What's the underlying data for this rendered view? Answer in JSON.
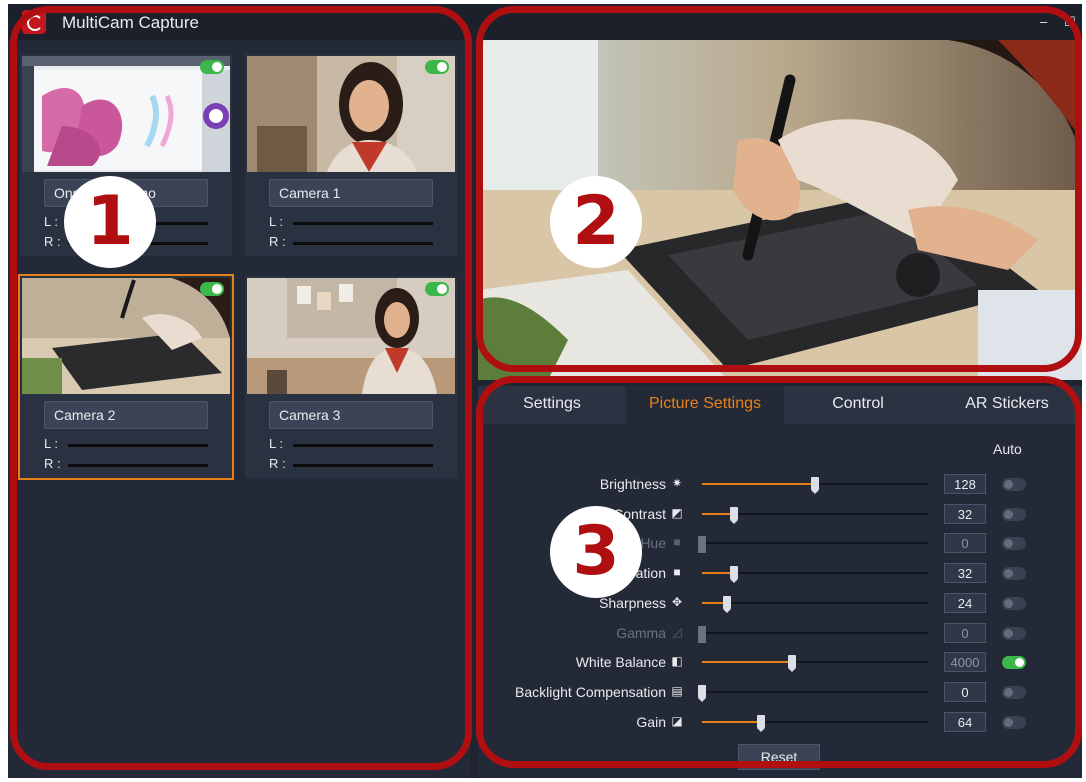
{
  "app": {
    "title": "MultiCam Capture",
    "minimize": "–",
    "maximize": "☐"
  },
  "cameras": [
    {
      "name": "Onscreen Demo",
      "left_label": "L :",
      "right_label": "R :",
      "enabled": true,
      "selected": false
    },
    {
      "name": "Camera 1",
      "left_label": "L :",
      "right_label": "R :",
      "enabled": true,
      "selected": false
    },
    {
      "name": "Camera 2",
      "left_label": "L :",
      "right_label": "R :",
      "enabled": true,
      "selected": true
    },
    {
      "name": "Camera 3",
      "left_label": "L :",
      "right_label": "R :",
      "enabled": true,
      "selected": false
    }
  ],
  "tabs": [
    {
      "label": "Settings",
      "active": false
    },
    {
      "label": "Picture Settings",
      "active": true
    },
    {
      "label": "Control",
      "active": false
    },
    {
      "label": "AR Stickers",
      "active": false
    }
  ],
  "picture_settings": {
    "auto_label": "Auto",
    "rows": [
      {
        "label": "Brightness",
        "icon": "sun-icon",
        "glyph": "✷",
        "value": "128",
        "level": 0.5,
        "enabled": true,
        "auto": false
      },
      {
        "label": "Contrast",
        "icon": "contrast-icon",
        "glyph": "◩",
        "value": "32",
        "level": 0.14,
        "enabled": true,
        "auto": false
      },
      {
        "label": "Hue",
        "icon": "hue-icon",
        "glyph": "■",
        "value": "0",
        "level": 0.0,
        "enabled": false,
        "auto": false
      },
      {
        "label": "Saturation",
        "icon": "saturation-icon",
        "glyph": "■",
        "value": "32",
        "level": 0.14,
        "enabled": true,
        "auto": false
      },
      {
        "label": "Sharpness",
        "icon": "sharpness-icon",
        "glyph": "✥",
        "value": "24",
        "level": 0.11,
        "enabled": true,
        "auto": false
      },
      {
        "label": "Gamma",
        "icon": "gamma-icon",
        "glyph": "◿",
        "value": "0",
        "level": 0.0,
        "enabled": false,
        "auto": false
      },
      {
        "label": "White Balance",
        "icon": "white-balance-icon",
        "glyph": "◧",
        "value": "4000",
        "level": 0.4,
        "enabled": true,
        "auto": true
      },
      {
        "label": "Backlight Compensation",
        "icon": "backlight-icon",
        "glyph": "▤",
        "value": "0",
        "level": 0.0,
        "enabled": true,
        "auto": false
      },
      {
        "label": "Gain",
        "icon": "gain-icon",
        "glyph": "◪",
        "value": "64",
        "level": 0.26,
        "enabled": true,
        "auto": false
      }
    ],
    "reset_label": "Reset"
  },
  "callouts": [
    "1",
    "2",
    "3"
  ],
  "colors": {
    "accent": "#e8801a",
    "toggle_on": "#3cb84a",
    "callout": "#b00f12"
  }
}
